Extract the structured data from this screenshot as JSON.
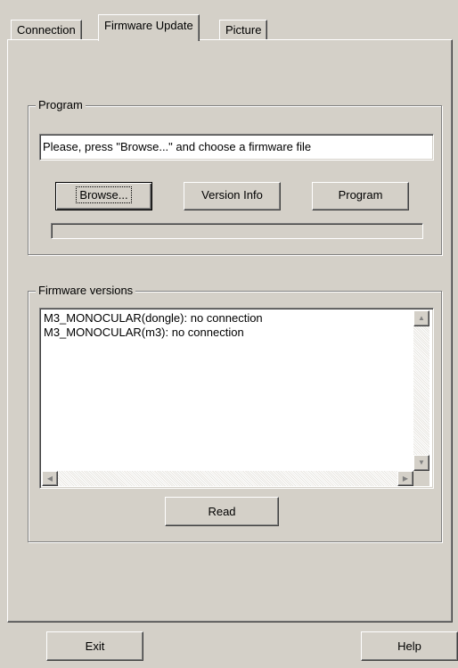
{
  "tabs": [
    "Connection",
    "Firmware Update",
    "Picture"
  ],
  "program": {
    "legend": "Program",
    "file_field_value": "Please, press \"Browse...\" and choose a firmware file",
    "browse_label": "Browse...",
    "version_info_label": "Version Info",
    "program_label": "Program",
    "progress": 0
  },
  "firmware": {
    "legend": "Firmware versions",
    "lines": [
      "M3_MONOCULAR(dongle): no connection",
      "M3_MONOCULAR(m3): no connection"
    ],
    "read_label": "Read"
  },
  "footer": {
    "exit_label": "Exit",
    "help_label": "Help"
  },
  "icons": {
    "scroll_up": "arrow-up-icon",
    "scroll_down": "arrow-down-icon",
    "scroll_left": "arrow-left-icon",
    "scroll_right": "arrow-right-icon"
  }
}
